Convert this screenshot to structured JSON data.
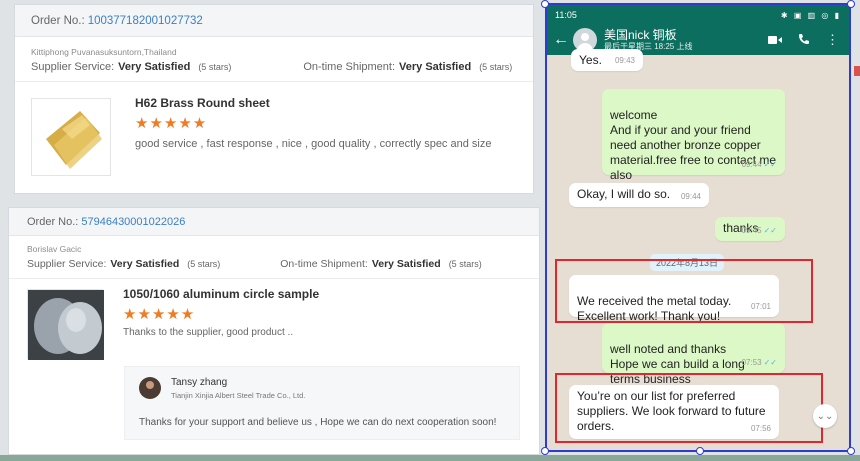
{
  "review1": {
    "order_label": "Order No.:",
    "order_no": "100377182001027732",
    "buyer": "Kittiphong Puvanasuksuntorn,Thailand",
    "supplier_label": "Supplier Service:",
    "supplier_value": "Very Satisfied",
    "supplier_stars": "(5 stars)",
    "shipment_label": "On-time Shipment:",
    "shipment_value": "Very Satisfied",
    "shipment_stars": "(5 stars)",
    "product_title": "H62 Brass Round sheet",
    "rating": "★★★★★",
    "comment": "good service , fast response , nice , good quality , correctly spec and size",
    "thumb_color": "#d9b34a"
  },
  "review2": {
    "order_label": "Order No.:",
    "order_no": "57946430001022026",
    "buyer": "Borislav Gacic",
    "supplier_label": "Supplier Service:",
    "supplier_value": "Very Satisfied",
    "supplier_stars": "(5 stars)",
    "shipment_label": "On-time Shipment:",
    "shipment_value": "Very Satisfied",
    "shipment_stars": "(5 stars)",
    "product_title": "1050/1060 aluminum circle sample",
    "rating": "★★★★★",
    "comment": "Thanks to the supplier, good product ..",
    "reply": {
      "name": "Tansy zhang",
      "company": "Tianjin Xinjia Albert Steel Trade Co., Ltd.",
      "text": "Thanks for your support and believe us , Hope we can do next cooperation soon!"
    }
  },
  "phone": {
    "status_time": "11:05",
    "status_icons": "✱ ▣ ▥ ◎ ▮",
    "contact_name": "美国nick 铜板",
    "contact_status": "最后于星期三 18:25 上线",
    "icons": [
      "video-icon",
      "phone-icon",
      "more-icon"
    ],
    "messages": [
      {
        "dir": "in",
        "text": "Yes.",
        "time": "09:43"
      },
      {
        "dir": "out",
        "text": "welcome\nAnd if  your  and your friend need another bronze copper material.free free to contact me also",
        "time": "09:44"
      },
      {
        "dir": "in",
        "text": "Okay, I will do so.",
        "time": "09:44"
      },
      {
        "dir": "out",
        "text": "thanks",
        "time": "09:45"
      },
      {
        "dir": "in",
        "text": "We received the metal today.\nExcellent work! Thank you!",
        "time": "07:01"
      },
      {
        "dir": "out",
        "text": "well noted and thanks\nHope we can build a long terms business",
        "time": "07:53"
      },
      {
        "dir": "in",
        "text": "You’re on our list for preferred suppliers. We look forward to future orders.",
        "time": "07:56"
      }
    ],
    "date_chip": "2022年8月13日",
    "accent": "#0b6e5f",
    "highlight": "#e0262e"
  }
}
